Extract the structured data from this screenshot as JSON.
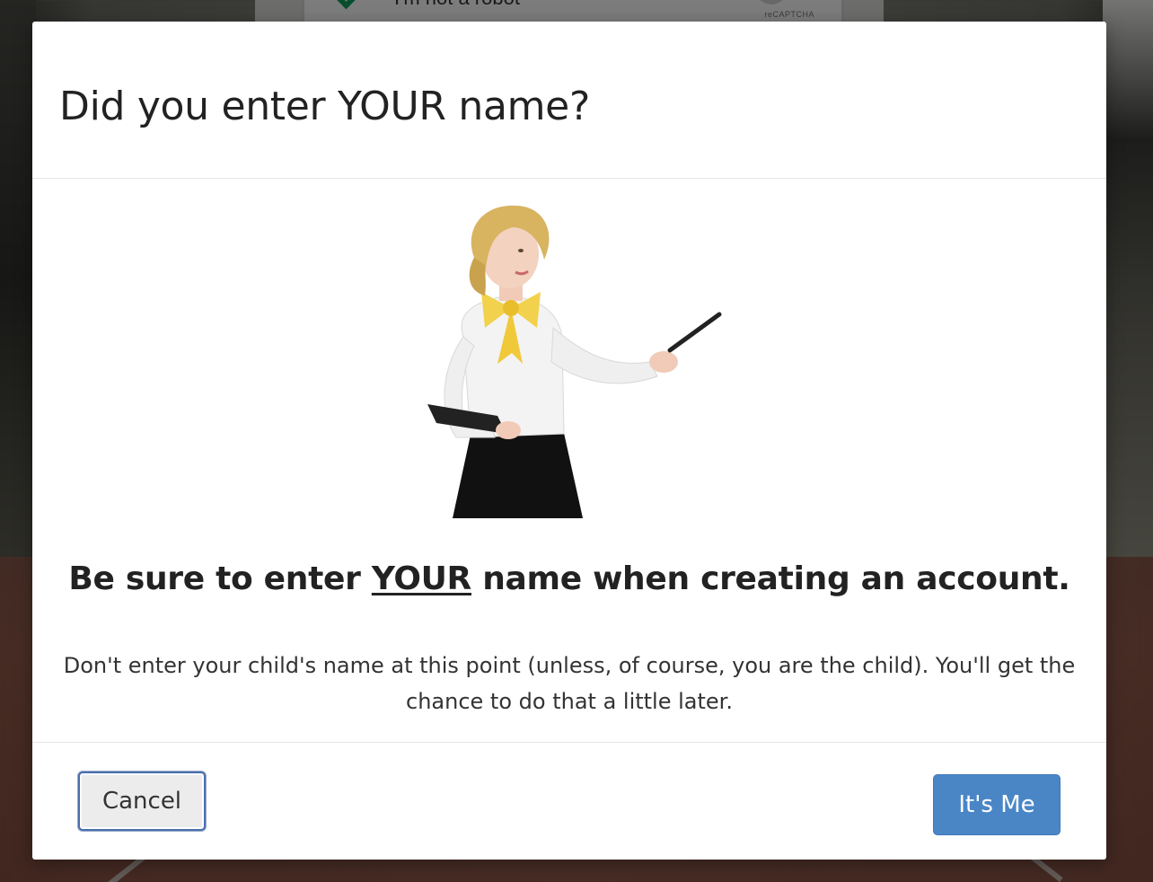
{
  "background": {
    "captcha_label": "I'm not a robot",
    "captcha_brand": "reCAPTCHA"
  },
  "modal": {
    "title": "Did you enter YOUR name?",
    "headline_before": "Be sure to enter ",
    "headline_emphasis": "YOUR",
    "headline_after": " name when creating an account.",
    "body_text": "Don't enter your child's name at this point (unless, of course, you are the child). You'll get the chance to do that a little later.",
    "cancel_label": "Cancel",
    "confirm_label": "It's Me"
  },
  "colors": {
    "primary": "#4a86c6",
    "cancel_focus_ring": "#4a6fb0",
    "captcha_check": "#0e9d58"
  },
  "icons": {
    "illustration": "presenter-woman-pointing-illustration",
    "captcha": "green-checkmark-icon"
  }
}
